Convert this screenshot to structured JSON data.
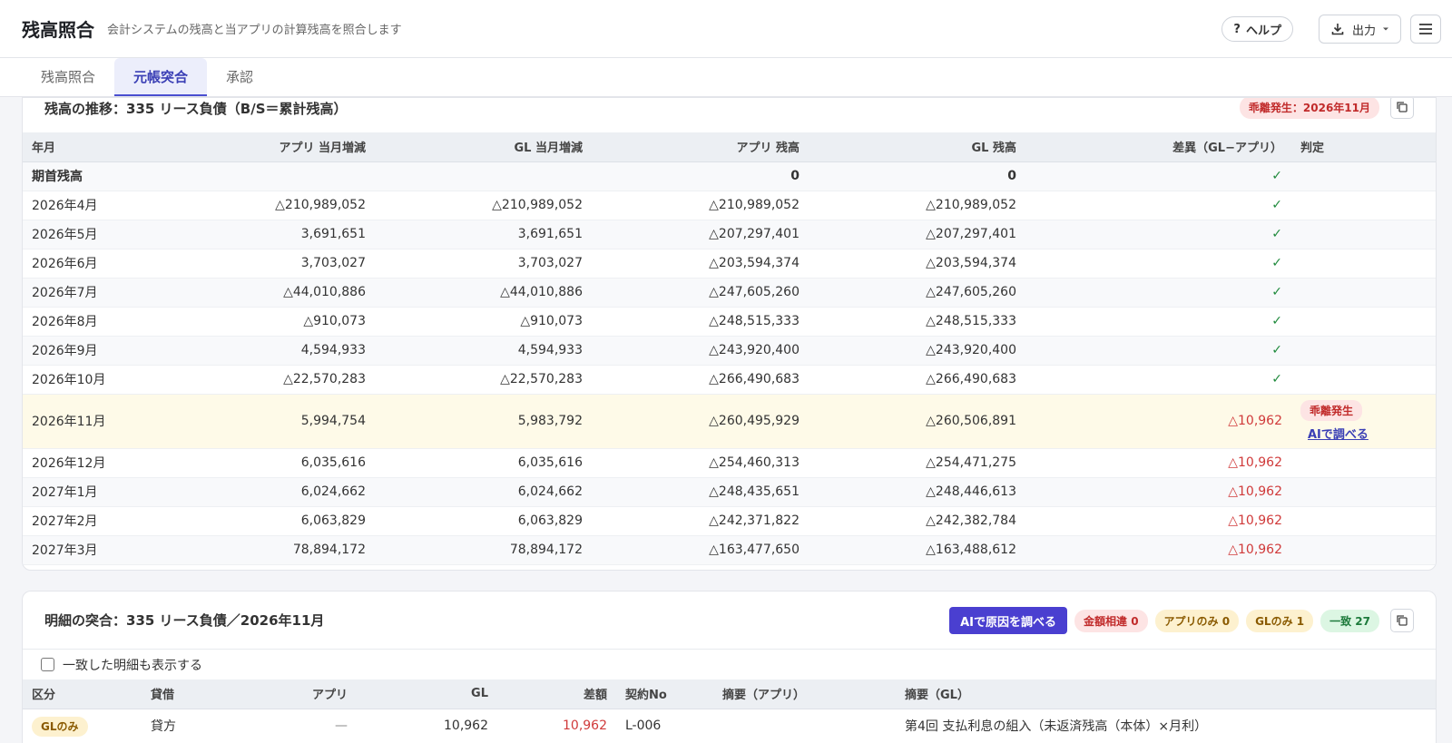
{
  "header": {
    "title": "残高照合",
    "subtitle": "会計システムの残高と当アプリの計算残高を照合します",
    "help_label": "ヘルプ",
    "help_icon": "?",
    "output_label": "出力"
  },
  "tabs": [
    {
      "label": "残高照合",
      "active": false
    },
    {
      "label": "元帳突合",
      "active": true
    },
    {
      "label": "承認",
      "active": false
    }
  ],
  "trend": {
    "title": "残高の推移：335 リース負債（B/S＝累計残高）",
    "badge": "乖離発生：2026年11月",
    "columns": [
      "年月",
      "アプリ 当月増減",
      "GL 当月増減",
      "アプリ 残高",
      "GL 残高",
      "差異（GL−アプリ）",
      "判定"
    ],
    "opening": {
      "label": "期首残高",
      "app_balance": "0",
      "gl_balance": "0",
      "diff": "✓"
    },
    "rows": [
      {
        "month": "2026年4月",
        "app_change": "△210,989,052",
        "gl_change": "△210,989,052",
        "app_balance": "△210,989,052",
        "gl_balance": "△210,989,052",
        "diff": "✓",
        "status": "ok"
      },
      {
        "month": "2026年5月",
        "app_change": "3,691,651",
        "gl_change": "3,691,651",
        "app_balance": "△207,297,401",
        "gl_balance": "△207,297,401",
        "diff": "✓",
        "status": "ok"
      },
      {
        "month": "2026年6月",
        "app_change": "3,703,027",
        "gl_change": "3,703,027",
        "app_balance": "△203,594,374",
        "gl_balance": "△203,594,374",
        "diff": "✓",
        "status": "ok"
      },
      {
        "month": "2026年7月",
        "app_change": "△44,010,886",
        "gl_change": "△44,010,886",
        "app_balance": "△247,605,260",
        "gl_balance": "△247,605,260",
        "diff": "✓",
        "status": "ok"
      },
      {
        "month": "2026年8月",
        "app_change": "△910,073",
        "gl_change": "△910,073",
        "app_balance": "△248,515,333",
        "gl_balance": "△248,515,333",
        "diff": "✓",
        "status": "ok"
      },
      {
        "month": "2026年9月",
        "app_change": "4,594,933",
        "gl_change": "4,594,933",
        "app_balance": "△243,920,400",
        "gl_balance": "△243,920,400",
        "diff": "✓",
        "status": "ok"
      },
      {
        "month": "2026年10月",
        "app_change": "△22,570,283",
        "gl_change": "△22,570,283",
        "app_balance": "△266,490,683",
        "gl_balance": "△266,490,683",
        "diff": "✓",
        "status": "ok"
      },
      {
        "month": "2026年11月",
        "app_change": "5,994,754",
        "gl_change": "5,983,792",
        "app_balance": "△260,495,929",
        "gl_balance": "△260,506,891",
        "diff": "△10,962",
        "status": "diverge",
        "judge_badge": "乖離発生",
        "judge_link": "AIで調べる"
      },
      {
        "month": "2026年12月",
        "app_change": "6,035,616",
        "gl_change": "6,035,616",
        "app_balance": "△254,460,313",
        "gl_balance": "△254,471,275",
        "diff": "△10,962",
        "status": "neg"
      },
      {
        "month": "2027年1月",
        "app_change": "6,024,662",
        "gl_change": "6,024,662",
        "app_balance": "△248,435,651",
        "gl_balance": "△248,446,613",
        "diff": "△10,962",
        "status": "neg"
      },
      {
        "month": "2027年2月",
        "app_change": "6,063,829",
        "gl_change": "6,063,829",
        "app_balance": "△242,371,822",
        "gl_balance": "△242,382,784",
        "diff": "△10,962",
        "status": "neg"
      },
      {
        "month": "2027年3月",
        "app_change": "78,894,172",
        "gl_change": "78,894,172",
        "app_balance": "△163,477,650",
        "gl_balance": "△163,488,612",
        "diff": "△10,962",
        "status": "neg"
      }
    ]
  },
  "detail": {
    "title": "明細の突合：335 リース負債／2026年11月",
    "ai_button": "AIで原因を調べる",
    "pills": {
      "amount_diff": "金額相違 0",
      "app_only": "アプリのみ 0",
      "gl_only": "GLのみ 1",
      "match": "一致 27"
    },
    "show_matched_label": "一致した明細も表示する",
    "columns": [
      "区分",
      "貸借",
      "アプリ",
      "GL",
      "差額",
      "契約No",
      "摘要（アプリ）",
      "摘要（GL）"
    ],
    "rows": [
      {
        "type": "GLのみ",
        "side": "貸方",
        "app": "—",
        "gl": "10,962",
        "diff": "10,962",
        "contract": "L-006",
        "memo_app": "",
        "memo_gl": "第4回 支払利息の組入（未返済残高（本体）×月利）"
      }
    ]
  }
}
